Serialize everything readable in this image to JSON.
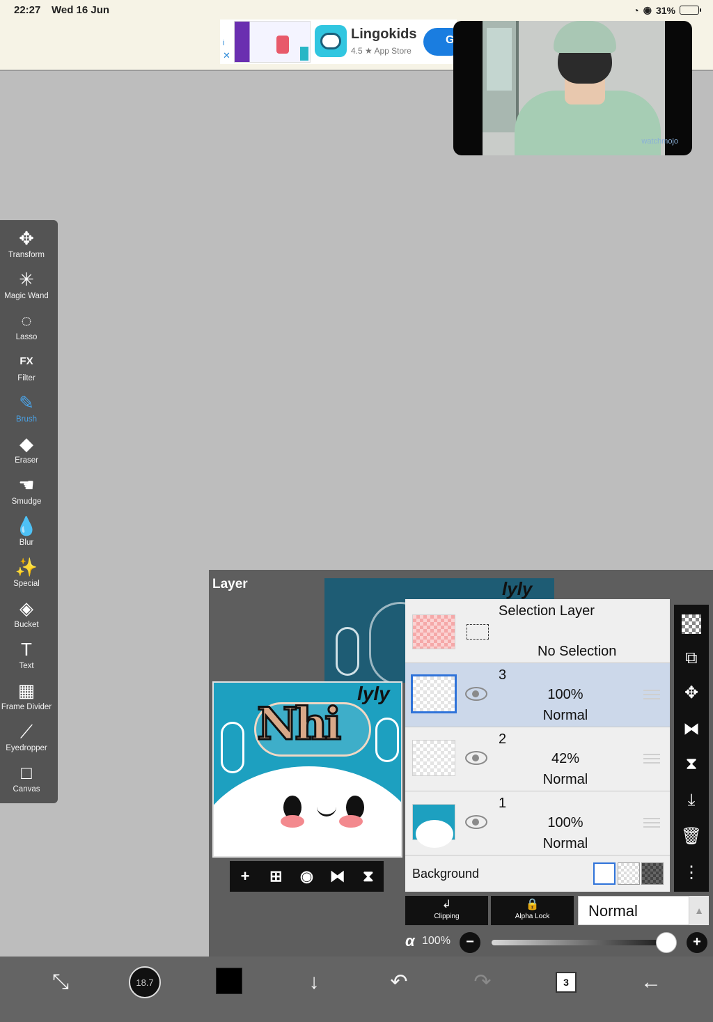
{
  "status_bar": {
    "time": "22:27",
    "date": "Wed 16 Jun",
    "battery": "31%"
  },
  "ad": {
    "app_name": "Lingokids",
    "rating": "4.5 ★ App Store",
    "cta": "G",
    "info_icon": "i",
    "close_icon": "✕"
  },
  "video_overlay": {
    "watermark": "watchmojo"
  },
  "toolbar": {
    "tools": [
      {
        "label": "Transform",
        "icon": "✥",
        "active": false
      },
      {
        "label": "Magic Wand",
        "icon": "✳",
        "active": false
      },
      {
        "label": "Lasso",
        "icon": "◌",
        "active": false
      },
      {
        "label": "Filter",
        "icon": "FX",
        "active": false
      },
      {
        "label": "Brush",
        "icon": "✎",
        "active": true
      },
      {
        "label": "Eraser",
        "icon": "◆",
        "active": false
      },
      {
        "label": "Smudge",
        "icon": "☚",
        "active": false
      },
      {
        "label": "Blur",
        "icon": "💧",
        "active": false
      },
      {
        "label": "Special",
        "icon": "✨",
        "active": false
      },
      {
        "label": "Bucket",
        "icon": "◈",
        "active": false
      },
      {
        "label": "Text",
        "icon": "T",
        "active": false
      },
      {
        "label": "Frame Divider",
        "icon": "▦",
        "active": false
      },
      {
        "label": "Eyedropper",
        "icon": "⟋",
        "active": false
      },
      {
        "label": "Canvas",
        "icon": "□",
        "active": false
      }
    ]
  },
  "layer_panel": {
    "title": "Layer",
    "canvas_text": "lyly",
    "canvas_title": "Nhi",
    "preview_actions": [
      "+",
      "⊞",
      "◉",
      "⧓",
      "⧗"
    ],
    "selection_layer": {
      "name": "Selection Layer",
      "status": "No Selection"
    },
    "layers": [
      {
        "number": "3",
        "opacity": "100%",
        "mode": "Normal",
        "selected": true
      },
      {
        "number": "2",
        "opacity": "42%",
        "mode": "Normal",
        "selected": false
      },
      {
        "number": "1",
        "opacity": "100%",
        "mode": "Normal",
        "selected": false
      }
    ],
    "background_label": "Background",
    "side_actions": [
      "checker",
      "⧉",
      "✥",
      "⧓",
      "⧗",
      "⤓",
      "🗑",
      "⋮"
    ],
    "clipping_label": "Clipping",
    "clipping_icon": "↲",
    "alpha_lock_label": "Alpha Lock",
    "alpha_lock_icon": "🔒",
    "blend_mode": "Normal",
    "blend_arrow": "▲",
    "alpha_symbol": "α",
    "alpha_value": "100%",
    "alpha_level": 1.0
  },
  "bottom_bar": {
    "brush_size": "18.7",
    "layer_count": "3",
    "down_icon": "↓",
    "undo_icon": "↶",
    "redo_icon": "↷",
    "back_icon": "←",
    "transform_icon": "⤡"
  }
}
